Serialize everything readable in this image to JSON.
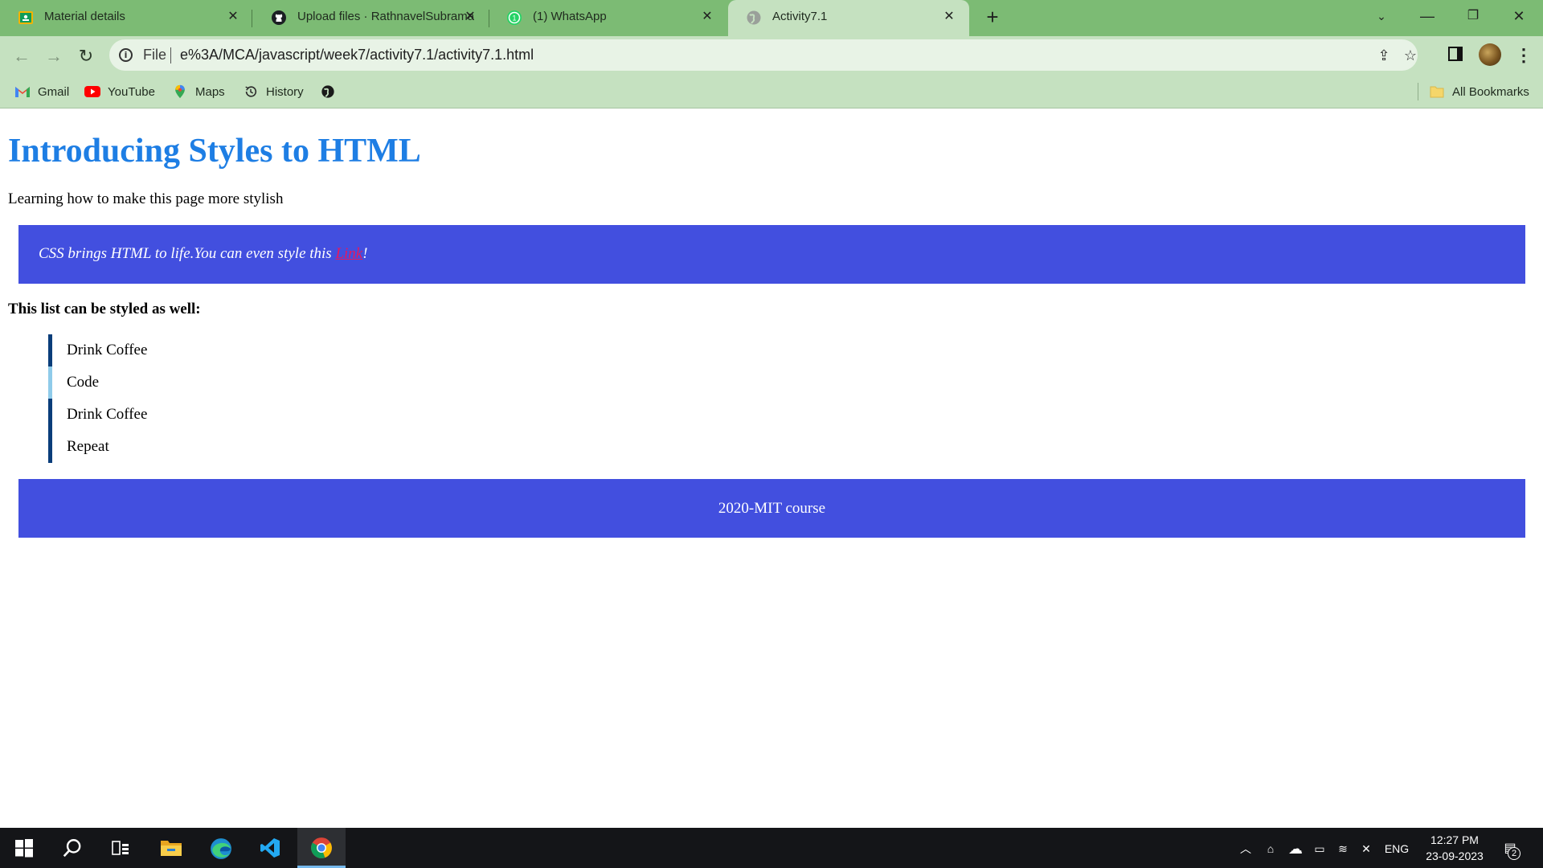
{
  "browser": {
    "tabs": [
      {
        "title": "Material details",
        "icon": "google-classroom-icon",
        "active": false
      },
      {
        "title": "Upload files · RathnavelSubramani",
        "icon": "github-icon",
        "active": false
      },
      {
        "title": "(1) WhatsApp",
        "icon": "whatsapp-icon",
        "active": false
      },
      {
        "title": "Activity7.1",
        "icon": "globe-icon",
        "active": true
      }
    ],
    "omnibox": {
      "scheme": "File",
      "url": "e%3A/MCA/javascript/week7/activity7.1/activity7.1.html"
    },
    "bookmarks": [
      {
        "label": "Gmail",
        "icon": "gmail-icon"
      },
      {
        "label": "YouTube",
        "icon": "youtube-icon"
      },
      {
        "label": "Maps",
        "icon": "maps-icon"
      },
      {
        "label": "History",
        "icon": "history-icon"
      },
      {
        "label": "",
        "icon": "globe-icon"
      }
    ],
    "all_bookmarks": "All Bookmarks"
  },
  "page": {
    "heading": "Introducing Styles to HTML",
    "subtitle": "Learning how to make this page more stylish",
    "banner": {
      "text_before": "CSS brings HTML to life.You can even style this ",
      "link_text": "Link",
      "text_after": "!"
    },
    "list_heading": "This list can be styled as well:",
    "list_items": [
      "Drink Coffee",
      "Code",
      "Drink Coffee",
      "Repeat"
    ],
    "footer": "2020-MIT course"
  },
  "colors": {
    "tab_strip": "#7cbb74",
    "toolbar": "#c5e1c0",
    "heading": "#1e7ee4",
    "banner_bg": "#424fdf",
    "link": "#e8175d",
    "list_border_dark": "#0a3d7a",
    "list_border_light": "#8fcbea"
  },
  "taskbar": {
    "apps": [
      "windows-start-icon",
      "search-icon",
      "task-view-icon",
      "file-explorer-icon",
      "edge-icon",
      "vscode-icon",
      "chrome-icon"
    ],
    "language": "ENG",
    "time": "12:27 PM",
    "date": "23-09-2023",
    "notifications": "2"
  }
}
